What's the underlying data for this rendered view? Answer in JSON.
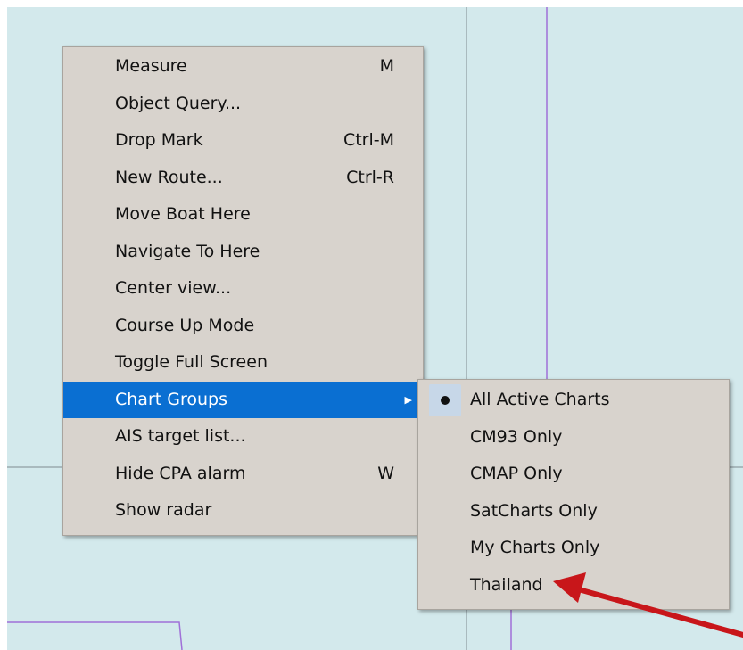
{
  "colors": {
    "chart_bg": "#d3e9ec",
    "grid_line": "#7f8b90",
    "boundary_line": "#a070d8",
    "menu_bg": "#d8d3cd",
    "selection": "#0a6fd2",
    "annotation_arrow": "#c8161a"
  },
  "context_menu": {
    "items": [
      {
        "label": "Measure",
        "shortcut": "M"
      },
      {
        "label": "Object Query...",
        "shortcut": ""
      },
      {
        "label": "Drop Mark",
        "shortcut": "Ctrl-M"
      },
      {
        "label": "New Route...",
        "shortcut": "Ctrl-R"
      },
      {
        "label": "Move Boat Here",
        "shortcut": ""
      },
      {
        "label": "Navigate To Here",
        "shortcut": ""
      },
      {
        "label": "Center view...",
        "shortcut": ""
      },
      {
        "label": "Course Up Mode",
        "shortcut": ""
      },
      {
        "label": "Toggle Full Screen",
        "shortcut": ""
      },
      {
        "label": "Chart Groups",
        "shortcut": "",
        "submenu_icon": "chevron-right-icon",
        "selected": true
      },
      {
        "label": "AIS target list...",
        "shortcut": ""
      },
      {
        "label": "Hide CPA alarm",
        "shortcut": "W"
      },
      {
        "label": "Show radar",
        "shortcut": ""
      }
    ]
  },
  "chart_groups_submenu": {
    "items": [
      {
        "label": "All Active Charts",
        "checked": true,
        "icon": "radio-dot-icon"
      },
      {
        "label": "CM93 Only",
        "checked": false
      },
      {
        "label": "CMAP Only",
        "checked": false
      },
      {
        "label": "SatCharts Only",
        "checked": false
      },
      {
        "label": "My Charts Only",
        "checked": false
      },
      {
        "label": "Thailand",
        "checked": false
      }
    ]
  },
  "annotation": {
    "icon": "red-arrow-annotation",
    "points_to": "Thailand"
  }
}
